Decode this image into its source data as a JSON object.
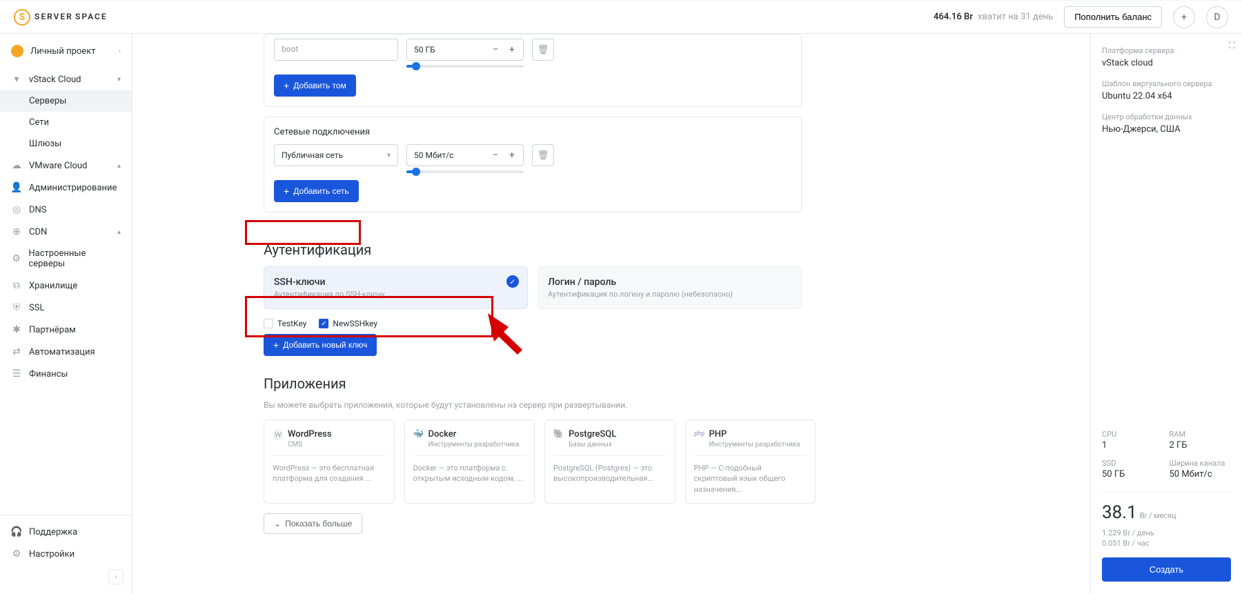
{
  "header": {
    "logo_main": "SERVER",
    "logo_sub": "SPACE",
    "balance_amount": "464.16 Br",
    "balance_days": "хватит на 31 день",
    "topup": "Пополнить баланс",
    "avatar_letter": "D"
  },
  "sidebar": {
    "project": "Личный проект",
    "vstack": "vStack Cloud",
    "vstack_items": {
      "servers": "Серверы",
      "networks": "Сети",
      "gateways": "Шлюзы"
    },
    "items": {
      "vmware": "VMware Cloud",
      "admin": "Администрирование",
      "dns": "DNS",
      "cdn": "CDN",
      "configured": "Настроенные серверы",
      "storage": "Хранилище",
      "ssl": "SSL",
      "partners": "Партнёрам",
      "automation": "Автоматизация",
      "finance": "Финансы"
    },
    "support": "Поддержка",
    "settings": "Настройки"
  },
  "main": {
    "volume": {
      "name": "boot",
      "value": "50 ГБ",
      "add_btn": "Добавить том"
    },
    "network": {
      "title": "Сетевые подключения",
      "name": "Публичная сеть",
      "value": "50 Мбит/с",
      "add_btn": "Добавить сеть"
    },
    "auth": {
      "title": "Аутентификация",
      "ssh_title": "SSH-ключи",
      "ssh_desc": "Аутентификация по SSH-ключу",
      "login_title": "Логин / пароль",
      "login_desc": "Аутентификация по логину и паролю (небезопасно)",
      "key1": "TestKey",
      "key2": "NewSSHkey",
      "add_key": "Добавить новый ключ"
    },
    "apps": {
      "title": "Приложения",
      "subtitle": "Вы можете выбрать приложения, которые будут установлены на сервер при развертывании.",
      "wp": {
        "name": "WordPress",
        "cat": "CMS",
        "desc": "WordPress — это бесплатная платформа для создания ..."
      },
      "docker": {
        "name": "Docker",
        "cat": "Инструменты разработчика",
        "desc": "Docker — это платформа с открытым исходным кодом, ..."
      },
      "pg": {
        "name": "PostgreSQL",
        "cat": "Базы данных",
        "desc": "PostgreSQL (Postgres) — это высокопроизводительная..."
      },
      "php": {
        "name": "PHP",
        "cat": "Инструменты разработчика",
        "desc": "PHP — C-подобный скриптовый язык общего назначения..."
      },
      "show_more": "Показать больше"
    }
  },
  "right": {
    "platform_label": "Платформа сервера",
    "platform_value": "vStack cloud",
    "template_label": "Шаблон виртуального сервера",
    "template_value": "Ubuntu 22.04 x64",
    "dc_label": "Центр обработки данных",
    "dc_value": "Нью-Джерси, США",
    "specs": {
      "cpu_l": "CPU",
      "cpu_v": "1",
      "ram_l": "RAM",
      "ram_v": "2 ГБ",
      "ssd_l": "SSD",
      "ssd_v": "50 ГБ",
      "bw_l": "Ширина канала",
      "bw_v": "50 Мбит/с"
    },
    "price_month": "38.1",
    "price_month_unit": "Br / месяц",
    "price_day": "1.229 Br / день",
    "price_hour": "0.051 Br / час",
    "create": "Создать"
  }
}
